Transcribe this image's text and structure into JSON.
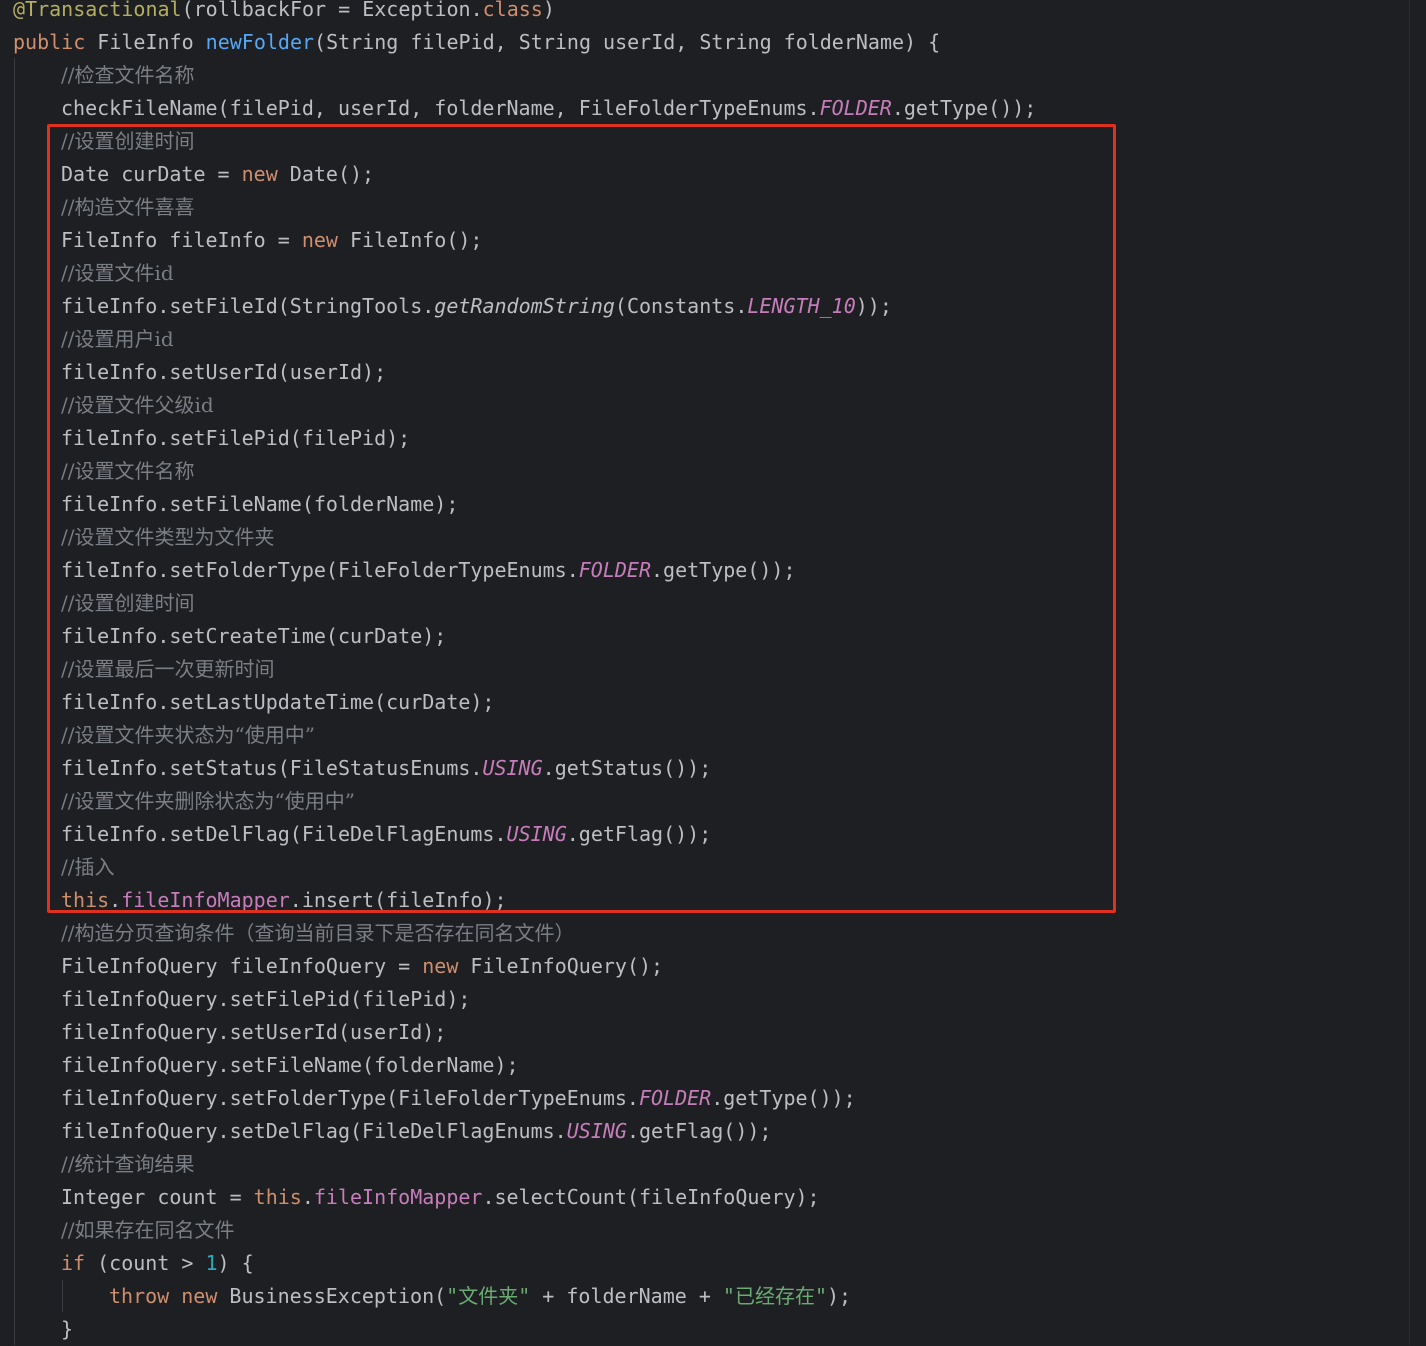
{
  "colors": {
    "background": "#1e1f22",
    "plain": "#bcbec4",
    "keyword": "#cf8e6d",
    "annotation": "#b3ae60",
    "method_decl": "#56a8f5",
    "field": "#c77dbb",
    "number": "#2aacb8",
    "string": "#6aab73",
    "comment": "#7a7e85",
    "highlight_box": "#e0301e"
  },
  "code_lines": [
    {
      "indent": 0,
      "tokens": [
        [
          "ann",
          "@Transactional"
        ],
        [
          "plain",
          "(rollbackFor = Exception."
        ],
        [
          "kw",
          "class"
        ],
        [
          "plain",
          ")"
        ]
      ]
    },
    {
      "indent": 0,
      "tokens": [
        [
          "kw",
          "public "
        ],
        [
          "plain",
          "FileInfo "
        ],
        [
          "fn",
          "newFolder"
        ],
        [
          "plain",
          "(String filePid, String userId, String folderName) {"
        ]
      ]
    },
    {
      "indent": 1,
      "tokens": [
        [
          "cmt",
          "//检查文件名称"
        ]
      ]
    },
    {
      "indent": 1,
      "tokens": [
        [
          "plain",
          "checkFileName(filePid, userId, folderName, FileFolderTypeEnums."
        ],
        [
          "static",
          "FOLDER"
        ],
        [
          "plain",
          ".getType());"
        ]
      ]
    },
    {
      "indent": 1,
      "tokens": [
        [
          "cmt",
          "//设置创建时间"
        ]
      ]
    },
    {
      "indent": 1,
      "tokens": [
        [
          "plain",
          "Date curDate = "
        ],
        [
          "kw",
          "new "
        ],
        [
          "plain",
          "Date();"
        ]
      ]
    },
    {
      "indent": 1,
      "tokens": [
        [
          "cmt",
          "//构造文件喜喜"
        ]
      ]
    },
    {
      "indent": 1,
      "tokens": [
        [
          "plain",
          "FileInfo fileInfo = "
        ],
        [
          "kw",
          "new "
        ],
        [
          "plain",
          "FileInfo();"
        ]
      ]
    },
    {
      "indent": 1,
      "tokens": [
        [
          "cmt",
          "//设置文件id"
        ]
      ]
    },
    {
      "indent": 1,
      "tokens": [
        [
          "plain",
          "fileInfo.setFileId(StringTools."
        ],
        [
          "italic",
          "getRandomString"
        ],
        [
          "plain",
          "(Constants."
        ],
        [
          "static",
          "LENGTH_10"
        ],
        [
          "plain",
          "));"
        ]
      ]
    },
    {
      "indent": 1,
      "tokens": [
        [
          "cmt",
          "//设置用户id"
        ]
      ]
    },
    {
      "indent": 1,
      "tokens": [
        [
          "plain",
          "fileInfo.setUserId(userId);"
        ]
      ]
    },
    {
      "indent": 1,
      "tokens": [
        [
          "cmt",
          "//设置文件父级id"
        ]
      ]
    },
    {
      "indent": 1,
      "tokens": [
        [
          "plain",
          "fileInfo.setFilePid(filePid);"
        ]
      ]
    },
    {
      "indent": 1,
      "tokens": [
        [
          "cmt",
          "//设置文件名称"
        ]
      ]
    },
    {
      "indent": 1,
      "tokens": [
        [
          "plain",
          "fileInfo.setFileName(folderName);"
        ]
      ]
    },
    {
      "indent": 1,
      "tokens": [
        [
          "cmt",
          "//设置文件类型为文件夹"
        ]
      ]
    },
    {
      "indent": 1,
      "tokens": [
        [
          "plain",
          "fileInfo.setFolderType(FileFolderTypeEnums."
        ],
        [
          "static",
          "FOLDER"
        ],
        [
          "plain",
          ".getType());"
        ]
      ]
    },
    {
      "indent": 1,
      "tokens": [
        [
          "cmt",
          "//设置创建时间"
        ]
      ]
    },
    {
      "indent": 1,
      "tokens": [
        [
          "plain",
          "fileInfo.setCreateTime(curDate);"
        ]
      ]
    },
    {
      "indent": 1,
      "tokens": [
        [
          "cmt",
          "//设置最后一次更新时间"
        ]
      ]
    },
    {
      "indent": 1,
      "tokens": [
        [
          "plain",
          "fileInfo.setLastUpdateTime(curDate);"
        ]
      ]
    },
    {
      "indent": 1,
      "tokens": [
        [
          "cmt",
          "//设置文件夹状态为“使用中”"
        ]
      ]
    },
    {
      "indent": 1,
      "tokens": [
        [
          "plain",
          "fileInfo.setStatus(FileStatusEnums."
        ],
        [
          "static",
          "USING"
        ],
        [
          "plain",
          ".getStatus());"
        ]
      ]
    },
    {
      "indent": 1,
      "tokens": [
        [
          "cmt",
          "//设置文件夹删除状态为“使用中”"
        ]
      ]
    },
    {
      "indent": 1,
      "tokens": [
        [
          "plain",
          "fileInfo.setDelFlag(FileDelFlagEnums."
        ],
        [
          "static",
          "USING"
        ],
        [
          "plain",
          ".getFlag());"
        ]
      ]
    },
    {
      "indent": 1,
      "tokens": [
        [
          "cmt",
          "//插入"
        ]
      ]
    },
    {
      "indent": 1,
      "tokens": [
        [
          "kw",
          "this"
        ],
        [
          "plain",
          "."
        ],
        [
          "field",
          "fileInfoMapper"
        ],
        [
          "plain",
          ".insert(fileInfo);"
        ]
      ]
    },
    {
      "indent": 1,
      "tokens": [
        [
          "cmt",
          "//构造分页查询条件（查询当前目录下是否存在同名文件）"
        ]
      ]
    },
    {
      "indent": 1,
      "tokens": [
        [
          "plain",
          "FileInfoQuery fileInfoQuery = "
        ],
        [
          "kw",
          "new "
        ],
        [
          "plain",
          "FileInfoQuery();"
        ]
      ]
    },
    {
      "indent": 1,
      "tokens": [
        [
          "plain",
          "fileInfoQuery.setFilePid(filePid);"
        ]
      ]
    },
    {
      "indent": 1,
      "tokens": [
        [
          "plain",
          "fileInfoQuery.setUserId(userId);"
        ]
      ]
    },
    {
      "indent": 1,
      "tokens": [
        [
          "plain",
          "fileInfoQuery.setFileName(folderName);"
        ]
      ]
    },
    {
      "indent": 1,
      "tokens": [
        [
          "plain",
          "fileInfoQuery.setFolderType(FileFolderTypeEnums."
        ],
        [
          "static",
          "FOLDER"
        ],
        [
          "plain",
          ".getType());"
        ]
      ]
    },
    {
      "indent": 1,
      "tokens": [
        [
          "plain",
          "fileInfoQuery.setDelFlag(FileDelFlagEnums."
        ],
        [
          "static",
          "USING"
        ],
        [
          "plain",
          ".getFlag());"
        ]
      ]
    },
    {
      "indent": 1,
      "tokens": [
        [
          "cmt",
          "//统计查询结果"
        ]
      ]
    },
    {
      "indent": 1,
      "tokens": [
        [
          "plain",
          "Integer count = "
        ],
        [
          "kw",
          "this"
        ],
        [
          "plain",
          "."
        ],
        [
          "field",
          "fileInfoMapper"
        ],
        [
          "plain",
          ".selectCount(fileInfoQuery);"
        ]
      ]
    },
    {
      "indent": 1,
      "tokens": [
        [
          "cmt",
          "//如果存在同名文件"
        ]
      ]
    },
    {
      "indent": 1,
      "tokens": [
        [
          "kw",
          "if "
        ],
        [
          "plain",
          "(count > "
        ],
        [
          "num",
          "1"
        ],
        [
          "plain",
          ") {"
        ]
      ]
    },
    {
      "indent": 2,
      "tokens": [
        [
          "kw",
          "throw new "
        ],
        [
          "plain",
          "BusinessException("
        ],
        [
          "str",
          "\"文件夹\""
        ],
        [
          "plain",
          " + folderName + "
        ],
        [
          "str",
          "\"已经存在\""
        ],
        [
          "plain",
          ");"
        ]
      ]
    },
    {
      "indent": 1,
      "tokens": [
        [
          "plain",
          "}"
        ]
      ]
    }
  ]
}
